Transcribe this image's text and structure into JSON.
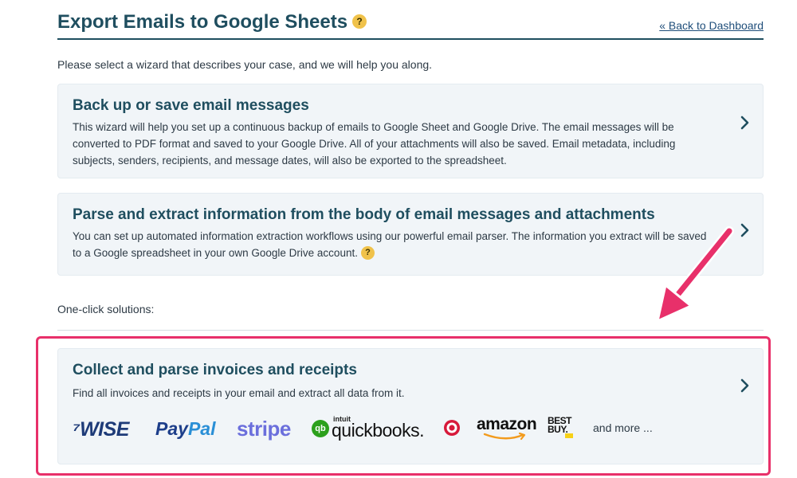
{
  "header": {
    "title": "Export Emails to Google Sheets",
    "help": "?",
    "back_link": "« Back to Dashboard"
  },
  "intro": "Please select a wizard that describes your case, and we will help you along.",
  "wizards": [
    {
      "title": "Back up or save email messages",
      "description": "This wizard will help you set up a continuous backup of emails to Google Sheet and Google Drive. The email messages will be converted to PDF format and saved to your Google Drive. All of your attachments will also be saved. Email metadata, including subjects, senders, recipients, and message dates, will also be exported to the spreadsheet."
    },
    {
      "title": "Parse and extract information from the body of email messages and attachments",
      "description": "You can set up automated information extraction workflows using our powerful email parser. The information you extract will be saved to a Google spreadsheet in your own Google Drive account.",
      "help": "?"
    }
  ],
  "one_click_label": "One-click solutions:",
  "solution": {
    "title": "Collect and parse invoices and receipts",
    "description": "Find all invoices and receipts in your email and extract all data from it.",
    "logos": {
      "wise": "WISE",
      "paypal_a": "Pay",
      "paypal_b": "Pal",
      "stripe": "stripe",
      "qb_mark": "qb",
      "qb_intuit": "intuit",
      "qb_word": "quickbooks.",
      "amazon": "amazon",
      "bestbuy_1": "BEST",
      "bestbuy_2": "BUY."
    },
    "more": "and more ..."
  },
  "colors": {
    "accent": "#1f4e5f",
    "highlight": "#e8306a",
    "card_bg": "#f1f5f8",
    "help_badge": "#f0c24a"
  }
}
